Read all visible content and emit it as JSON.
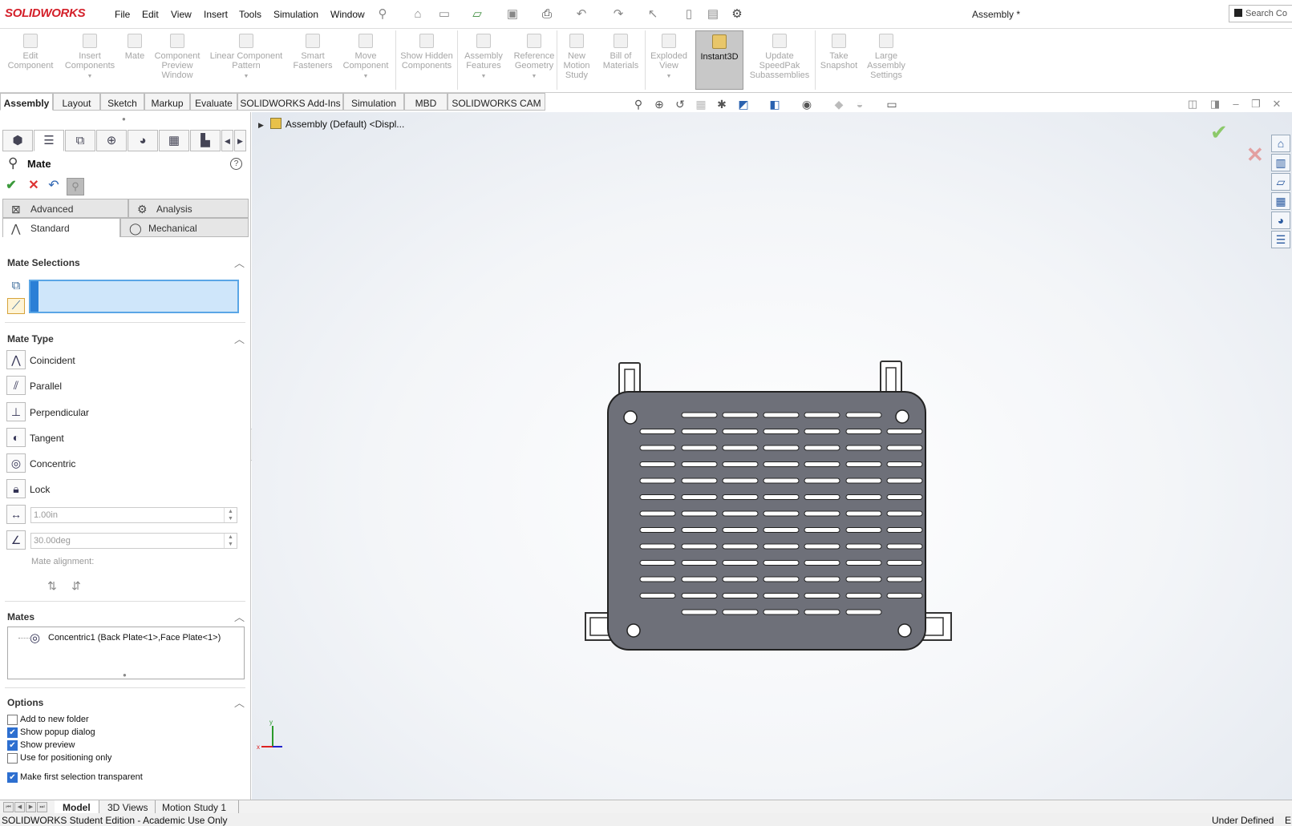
{
  "app": {
    "brand": "SOLIDWORKS",
    "document_title": "Assembly *",
    "search_placeholder": "Search Co"
  },
  "menus": [
    "File",
    "Edit",
    "View",
    "Insert",
    "Tools",
    "Simulation",
    "Window"
  ],
  "ribbon": [
    {
      "label": "Edit Component",
      "state": "disabled"
    },
    {
      "label": "Insert Components",
      "state": "disabled"
    },
    {
      "label": "Mate",
      "state": "disabled"
    },
    {
      "label": "Component Preview Window",
      "state": "disabled"
    },
    {
      "label": "Linear Component Pattern",
      "state": "disabled"
    },
    {
      "label": "Smart Fasteners",
      "state": "disabled"
    },
    {
      "label": "Move Component",
      "state": "disabled"
    },
    {
      "label": "Show Hidden Components",
      "state": "disabled"
    },
    {
      "label": "Assembly Features",
      "state": "disabled"
    },
    {
      "label": "Reference Geometry",
      "state": "disabled"
    },
    {
      "label": "New Motion Study",
      "state": "disabled"
    },
    {
      "label": "Bill of Materials",
      "state": "disabled"
    },
    {
      "label": "Exploded View",
      "state": "disabled"
    },
    {
      "label": "Instant3D",
      "state": "active"
    },
    {
      "label": "Update SpeedPak Subassemblies",
      "state": "disabled"
    },
    {
      "label": "Take Snapshot",
      "state": "disabled"
    },
    {
      "label": "Large Assembly Settings",
      "state": "disabled"
    }
  ],
  "command_tabs": [
    "Assembly",
    "Layout",
    "Sketch",
    "Markup",
    "Evaluate",
    "SOLIDWORKS Add-Ins",
    "Simulation",
    "MBD",
    "SOLIDWORKS CAM"
  ],
  "active_command_tab": "Assembly",
  "property_manager": {
    "title": "Mate",
    "help": "?",
    "subtabs": {
      "advanced": "Advanced",
      "analysis": "Analysis",
      "standard": "Standard",
      "mechanical": "Mechanical"
    },
    "sections": {
      "mate_selections": "Mate Selections",
      "mate_type": "Mate Type",
      "mates": "Mates",
      "options": "Options"
    },
    "mate_types": [
      "Coincident",
      "Parallel",
      "Perpendicular",
      "Tangent",
      "Concentric",
      "Lock"
    ],
    "distance_value": "1.00in",
    "angle_value": "30.00deg",
    "mate_alignment_label": "Mate alignment:",
    "mates_list": [
      "Concentric1 (Back Plate<1>,Face Plate<1>)"
    ],
    "options": [
      {
        "label": "Add to new folder",
        "checked": false
      },
      {
        "label": "Show popup dialog",
        "checked": true
      },
      {
        "label": "Show preview",
        "checked": true
      },
      {
        "label": "Use for positioning only",
        "checked": false
      },
      {
        "label": "Make first selection transparent",
        "checked": true
      }
    ]
  },
  "feature_tree": {
    "root": "Assembly (Default) <Displ..."
  },
  "triad": {
    "x": "x",
    "y": "y"
  },
  "bottom_tabs": [
    "Model",
    "3D Views",
    "Motion Study 1"
  ],
  "active_bottom_tab": "Model",
  "status": {
    "left": "SOLIDWORKS Student Edition - Academic Use Only",
    "right": "Under Defined",
    "right_suffix": "E"
  },
  "colors": {
    "brand_red": "#d4202a",
    "selection_fill": "#cfe6fa",
    "selection_border": "#5aa6e6",
    "checkbox_checked": "#2d6fd0",
    "part_gray": "#6e7079",
    "ok_green": "#8cc96a",
    "cancel_red": "#e3a0a0"
  }
}
